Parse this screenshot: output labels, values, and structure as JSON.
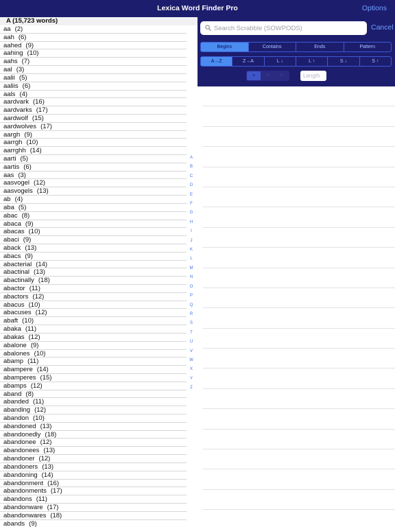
{
  "app": {
    "title": "Lexica Word Finder Pro",
    "options_label": "Options"
  },
  "search": {
    "placeholder": "Search Scrabble (SOWPODS)",
    "value": "",
    "cancel_label": "Cancel"
  },
  "mode_tabs": [
    {
      "label": "Begins",
      "active": true
    },
    {
      "label": "Contains",
      "active": false
    },
    {
      "label": "Ends",
      "active": false
    },
    {
      "label": "Pattern",
      "active": false
    }
  ],
  "sort_tabs": [
    {
      "label": "A→Z",
      "active": true
    },
    {
      "label": "Z→A",
      "active": false
    },
    {
      "label": "L ↓",
      "active": false
    },
    {
      "label": "L ↑",
      "active": false
    },
    {
      "label": "S ↓",
      "active": false
    },
    {
      "label": "S ↑",
      "active": false
    }
  ],
  "length_filter": {
    "operators": [
      {
        "label": "=",
        "active": true
      },
      {
        "label": "<",
        "active": false
      },
      {
        "label": ">",
        "active": false
      }
    ],
    "placeholder": "Length"
  },
  "word_list": {
    "section_header": "A (15,723 words)",
    "words": [
      {
        "word": "aa",
        "score": "(2)"
      },
      {
        "word": "aah",
        "score": "(6)"
      },
      {
        "word": "aahed",
        "score": "(9)"
      },
      {
        "word": "aahing",
        "score": "(10)"
      },
      {
        "word": "aahs",
        "score": "(7)"
      },
      {
        "word": "aal",
        "score": "(3)"
      },
      {
        "word": "aalii",
        "score": "(5)"
      },
      {
        "word": "aaliis",
        "score": "(6)"
      },
      {
        "word": "aals",
        "score": "(4)"
      },
      {
        "word": "aardvark",
        "score": "(16)"
      },
      {
        "word": "aardvarks",
        "score": "(17)"
      },
      {
        "word": "aardwolf",
        "score": "(15)"
      },
      {
        "word": "aardwolves",
        "score": "(17)"
      },
      {
        "word": "aargh",
        "score": "(9)"
      },
      {
        "word": "aarrgh",
        "score": "(10)"
      },
      {
        "word": "aarrghh",
        "score": "(14)"
      },
      {
        "word": "aarti",
        "score": "(5)"
      },
      {
        "word": "aartis",
        "score": "(6)"
      },
      {
        "word": "aas",
        "score": "(3)"
      },
      {
        "word": "aasvogel",
        "score": "(12)"
      },
      {
        "word": "aasvogels",
        "score": "(13)"
      },
      {
        "word": "ab",
        "score": "(4)"
      },
      {
        "word": "aba",
        "score": "(5)"
      },
      {
        "word": "abac",
        "score": "(8)"
      },
      {
        "word": "abaca",
        "score": "(9)"
      },
      {
        "word": "abacas",
        "score": "(10)"
      },
      {
        "word": "abaci",
        "score": "(9)"
      },
      {
        "word": "aback",
        "score": "(13)"
      },
      {
        "word": "abacs",
        "score": "(9)"
      },
      {
        "word": "abacterial",
        "score": "(14)"
      },
      {
        "word": "abactinal",
        "score": "(13)"
      },
      {
        "word": "abactinally",
        "score": "(18)"
      },
      {
        "word": "abactor",
        "score": "(11)"
      },
      {
        "word": "abactors",
        "score": "(12)"
      },
      {
        "word": "abacus",
        "score": "(10)"
      },
      {
        "word": "abacuses",
        "score": "(12)"
      },
      {
        "word": "abaft",
        "score": "(10)"
      },
      {
        "word": "abaka",
        "score": "(11)"
      },
      {
        "word": "abakas",
        "score": "(12)"
      },
      {
        "word": "abalone",
        "score": "(9)"
      },
      {
        "word": "abalones",
        "score": "(10)"
      },
      {
        "word": "abamp",
        "score": "(11)"
      },
      {
        "word": "abampere",
        "score": "(14)"
      },
      {
        "word": "abamperes",
        "score": "(15)"
      },
      {
        "word": "abamps",
        "score": "(12)"
      },
      {
        "word": "aband",
        "score": "(8)"
      },
      {
        "word": "abanded",
        "score": "(11)"
      },
      {
        "word": "abanding",
        "score": "(12)"
      },
      {
        "word": "abandon",
        "score": "(10)"
      },
      {
        "word": "abandoned",
        "score": "(13)"
      },
      {
        "word": "abandonedly",
        "score": "(18)"
      },
      {
        "word": "abandonee",
        "score": "(12)"
      },
      {
        "word": "abandonees",
        "score": "(13)"
      },
      {
        "word": "abandoner",
        "score": "(12)"
      },
      {
        "word": "abandoners",
        "score": "(13)"
      },
      {
        "word": "abandoning",
        "score": "(14)"
      },
      {
        "word": "abandonment",
        "score": "(16)"
      },
      {
        "word": "abandonments",
        "score": "(17)"
      },
      {
        "word": "abandons",
        "score": "(11)"
      },
      {
        "word": "abandonware",
        "score": "(17)"
      },
      {
        "word": "abandonwares",
        "score": "(18)"
      },
      {
        "word": "abands",
        "score": "(9)"
      }
    ]
  },
  "index_letters": [
    "A",
    "B",
    "C",
    "D",
    "E",
    "F",
    "G",
    "H",
    "I",
    "J",
    "K",
    "L",
    "M",
    "N",
    "O",
    "P",
    "Q",
    "R",
    "S",
    "T",
    "U",
    "V",
    "W",
    "X",
    "Y",
    "Z"
  ],
  "colors": {
    "nav_background": "#1d1d6e",
    "accent": "#6fa0ff",
    "segment_active": "#4a8cf0",
    "index_letter": "#3e6fe8"
  }
}
